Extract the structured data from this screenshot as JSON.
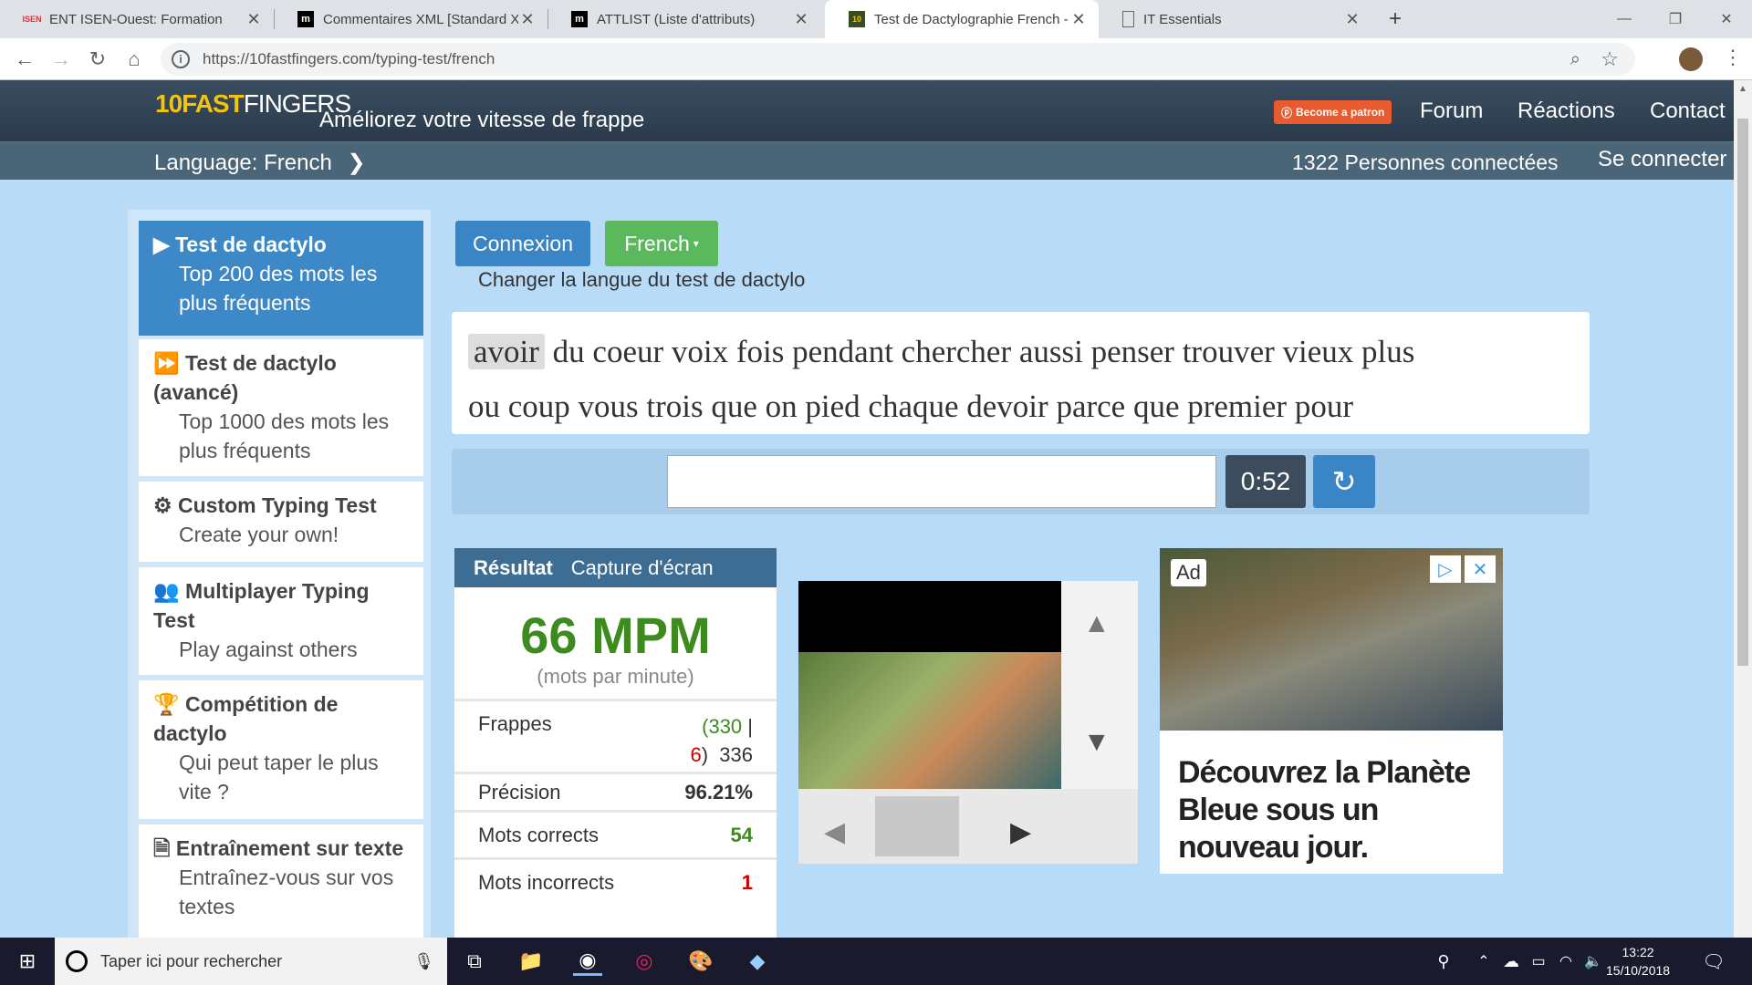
{
  "browser": {
    "tabs": [
      {
        "favicon": "ISEN",
        "label": "ENT ISEN-Ouest: Formation"
      },
      {
        "favicon": "m",
        "label": "Commentaires XML [Standard XM"
      },
      {
        "favicon": "m",
        "label": "ATTLIST (Liste d'attributs)"
      },
      {
        "favicon": "10",
        "label": "Test de Dactylographie French -"
      },
      {
        "favicon": "doc",
        "label": "IT Essentials"
      }
    ],
    "url": "https://10fastfingers.com/typing-test/french"
  },
  "site": {
    "logo_main": "10FAST",
    "logo_sub": "FINGERS",
    "tagline": "Améliorez votre vitesse de frappe",
    "patron": "Become a patron",
    "nav": [
      "Forum",
      "Réactions",
      "Contact"
    ],
    "language": "Language: French",
    "online": "1322 Personnes connectées",
    "login": "Se connecter"
  },
  "menu": [
    {
      "title": "Test de dactylo",
      "sub": "Top 200 des mots les plus fréquents"
    },
    {
      "title": "Test de dactylo (avancé)",
      "sub": "Top 1000 des mots les plus fréquents"
    },
    {
      "title": "Custom Typing Test",
      "sub": "Create your own!"
    },
    {
      "title": "Multiplayer Typing Test",
      "sub": "Play against others"
    },
    {
      "title": "Compétition de dactylo",
      "sub": "Qui peut taper le plus vite ?"
    },
    {
      "title": "Entraînement sur texte",
      "sub": "Entraînez-vous sur vos textes"
    }
  ],
  "main": {
    "connexion": "Connexion",
    "language_btn": "French",
    "change_lang": "Changer la langue du test de dactylo",
    "current_word": "avoir",
    "line1_rest": "du coeur voix fois pendant chercher aussi penser trouver vieux plus",
    "line2": "ou coup vous trois que on pied chaque devoir parce que premier pour",
    "timer": "0:52"
  },
  "result": {
    "tab_result": "Résultat",
    "tab_capture": "Capture d'écran",
    "wpm": "66 MPM",
    "wpm_sub": "(mots par minute)",
    "rows": {
      "keys_label": "Frappes",
      "keys_correct": "330",
      "keys_wrong": "6",
      "keys_total": "336",
      "precision_label": "Précision",
      "precision": "96.21%",
      "correct_label": "Mots corrects",
      "correct": "54",
      "wrong_label": "Mots incorrects",
      "wrong": "1"
    }
  },
  "ad": {
    "badge": "Ad",
    "text": "Découvrez la Planète Bleue sous un nouveau jour."
  },
  "taskbar": {
    "search_placeholder": "Taper ici pour rechercher",
    "time": "13:22",
    "date": "15/10/2018"
  }
}
